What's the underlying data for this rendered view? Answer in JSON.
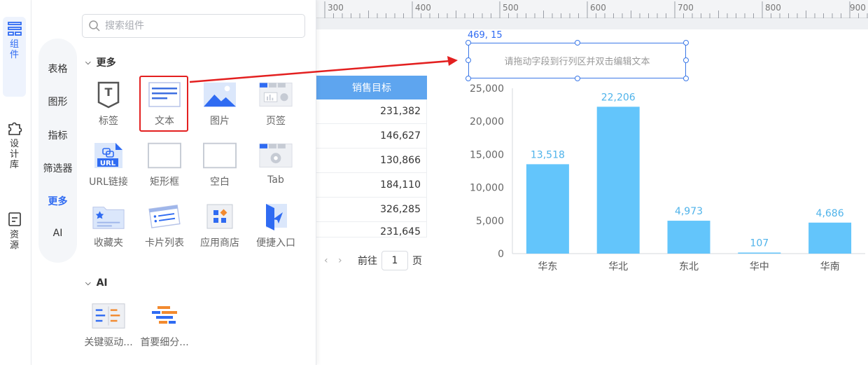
{
  "rail": {
    "items": [
      {
        "label": "组件",
        "icon": "component-icon",
        "active": true
      },
      {
        "label": "设计库",
        "icon": "puzzle-icon",
        "active": false
      },
      {
        "label": "资源",
        "icon": "resource-icon",
        "active": false
      }
    ]
  },
  "panel": {
    "search_placeholder": "搜索组件",
    "categories": [
      "表格",
      "图形",
      "指标",
      "筛选器",
      "更多",
      "AI"
    ],
    "active_category": "更多",
    "section_more": "更多",
    "section_ai": "AI",
    "components": [
      {
        "label": "标签",
        "icon": "tag-icon"
      },
      {
        "label": "文本",
        "icon": "text-icon"
      },
      {
        "label": "图片",
        "icon": "image-icon"
      },
      {
        "label": "页签",
        "icon": "tab-page-icon"
      },
      {
        "label": "URL链接",
        "icon": "url-link-icon"
      },
      {
        "label": "矩形框",
        "icon": "rectangle-icon"
      },
      {
        "label": "空白",
        "icon": "blank-icon"
      },
      {
        "label": "Tab",
        "icon": "tab-icon"
      },
      {
        "label": "收藏夹",
        "icon": "favorites-icon"
      },
      {
        "label": "卡片列表",
        "icon": "card-list-icon"
      },
      {
        "label": "应用商店",
        "icon": "app-store-icon"
      },
      {
        "label": "便捷入口",
        "icon": "shortcut-icon"
      }
    ],
    "ai_components": [
      {
        "label": "关键驱动...",
        "icon": "key-driver-icon"
      },
      {
        "label": "首要细分...",
        "icon": "top-segment-icon"
      }
    ]
  },
  "ruler": {
    "ticks": [
      "300",
      "400",
      "500",
      "600",
      "700",
      "800",
      "900"
    ]
  },
  "table": {
    "header": "销售目标",
    "rows": [
      "231,382",
      "146,627",
      "130,866",
      "184,110",
      "326,285",
      "231,645"
    ]
  },
  "pager": {
    "prefix": "前往",
    "page": "1",
    "suffix": "页"
  },
  "text_component": {
    "coords": "469, 15",
    "placeholder": "请拖动字段到行列区并双击编辑文本"
  },
  "colors": {
    "accent": "#2f6bf2",
    "bar": "#63c5fb",
    "table_header": "#5ea5ef",
    "highlight": "#e32020"
  },
  "chart_data": {
    "type": "bar",
    "categories": [
      "华东",
      "华北",
      "东北",
      "华中",
      "华南"
    ],
    "values": [
      13518,
      22206,
      4973,
      107,
      4686
    ],
    "value_labels": [
      "13,518",
      "22,206",
      "4,973",
      "107",
      "4,686"
    ],
    "y_ticks": [
      "0",
      "5,000",
      "10,000",
      "15,000",
      "20,000",
      "25,000"
    ],
    "ylim": [
      0,
      25000
    ],
    "grid": false
  }
}
